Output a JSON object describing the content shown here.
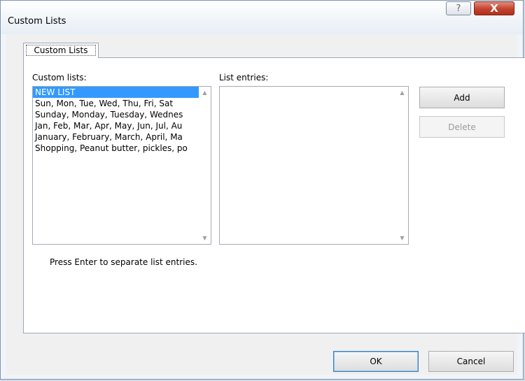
{
  "window": {
    "title": "Custom Lists",
    "help_glyph": "?",
    "close_glyph": "X"
  },
  "tab": {
    "label": "Custom Lists"
  },
  "custom_lists": {
    "label": "Custom lists:",
    "items": [
      "NEW LIST",
      "Sun, Mon, Tue, Wed, Thu, Fri, Sat",
      "Sunday, Monday, Tuesday, Wednes",
      "Jan, Feb, Mar, Apr, May, Jun, Jul, Au",
      "January, February, March, April, Ma",
      "Shopping, Peanut butter, pickles, po"
    ],
    "selected_index": 0
  },
  "list_entries": {
    "label": "List entries:",
    "value": ""
  },
  "buttons": {
    "add": "Add",
    "delete": "Delete",
    "ok": "OK",
    "cancel": "Cancel"
  },
  "hint": "Press Enter to separate list entries.",
  "scroll_glyphs": {
    "up": "▲",
    "down": "▼"
  },
  "colors": {
    "selection": "#3399ff",
    "close_button": "#c3422d"
  }
}
